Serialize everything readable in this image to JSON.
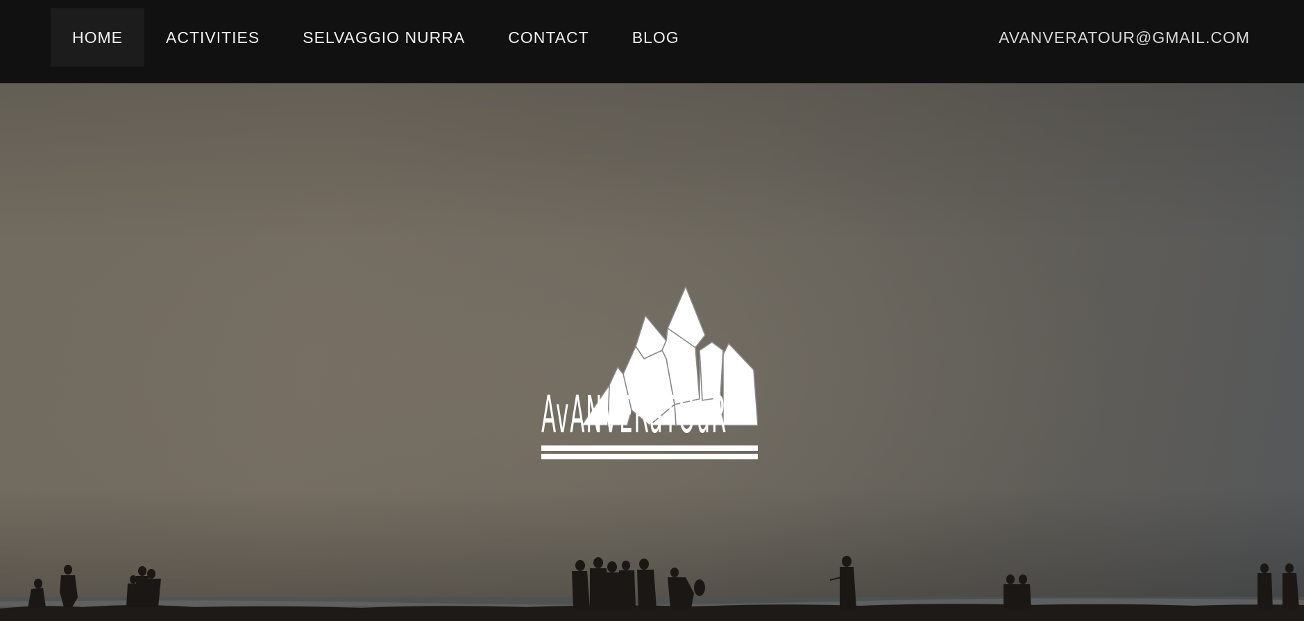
{
  "nav": {
    "items": [
      {
        "label": "HOME",
        "active": true
      },
      {
        "label": "ACTIVITIES",
        "active": false
      },
      {
        "label": "SELVAGGIO NURRA",
        "active": false
      },
      {
        "label": "CONTACT",
        "active": false
      },
      {
        "label": "BLOG",
        "active": false
      }
    ],
    "email": "AVANVERATOUR@GMAIL.COM"
  },
  "hero": {
    "logo_text": "AvANVERaTOuR",
    "logo_icon": "mountain-logo-icon"
  },
  "colors": {
    "navbar_bg": "#111111",
    "nav_text": "#f2f2f2",
    "active_item_bg": "#1c1c1c",
    "logo": "#ffffff"
  }
}
